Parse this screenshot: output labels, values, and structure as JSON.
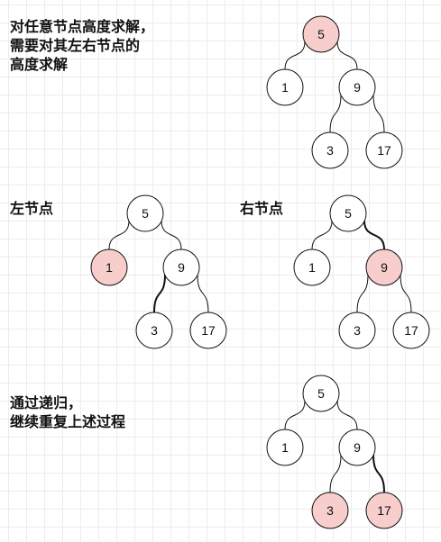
{
  "captions": {
    "intro": [
      "对任意节点高度求解，",
      "需要对其左右节点的",
      "高度求解"
    ],
    "left": "左节点",
    "right": "右节点",
    "recursion": [
      "通过递归，",
      "继续重复上述过程"
    ]
  },
  "trees": [
    {
      "id": "tree-intro",
      "nodes": [
        {
          "id": "root",
          "label": "5",
          "highlighted": true
        },
        {
          "id": "left",
          "label": "1",
          "highlighted": false
        },
        {
          "id": "right",
          "label": "9",
          "highlighted": false
        },
        {
          "id": "right-left",
          "label": "3",
          "highlighted": false
        },
        {
          "id": "right-right",
          "label": "17",
          "highlighted": false
        }
      ]
    },
    {
      "id": "tree-left",
      "nodes": [
        {
          "id": "root",
          "label": "5",
          "highlighted": false
        },
        {
          "id": "left",
          "label": "1",
          "highlighted": true
        },
        {
          "id": "right",
          "label": "9",
          "highlighted": false
        },
        {
          "id": "right-left",
          "label": "3",
          "highlighted": false
        },
        {
          "id": "right-right",
          "label": "17",
          "highlighted": false
        }
      ]
    },
    {
      "id": "tree-right",
      "nodes": [
        {
          "id": "root",
          "label": "5",
          "highlighted": false
        },
        {
          "id": "left",
          "label": "1",
          "highlighted": false
        },
        {
          "id": "right",
          "label": "9",
          "highlighted": true
        },
        {
          "id": "right-left",
          "label": "3",
          "highlighted": false
        },
        {
          "id": "right-right",
          "label": "17",
          "highlighted": false
        }
      ]
    },
    {
      "id": "tree-recursion",
      "nodes": [
        {
          "id": "root",
          "label": "5",
          "highlighted": false
        },
        {
          "id": "left",
          "label": "1",
          "highlighted": false
        },
        {
          "id": "right",
          "label": "9",
          "highlighted": false
        },
        {
          "id": "right-left",
          "label": "3",
          "highlighted": true
        },
        {
          "id": "right-right",
          "label": "17",
          "highlighted": true
        }
      ]
    }
  ],
  "colors": {
    "highlight_fill": "#f8cecc",
    "node_fill": "#ffffff",
    "node_stroke": "#111111",
    "edge": "#111111",
    "grid": "#ececec"
  }
}
